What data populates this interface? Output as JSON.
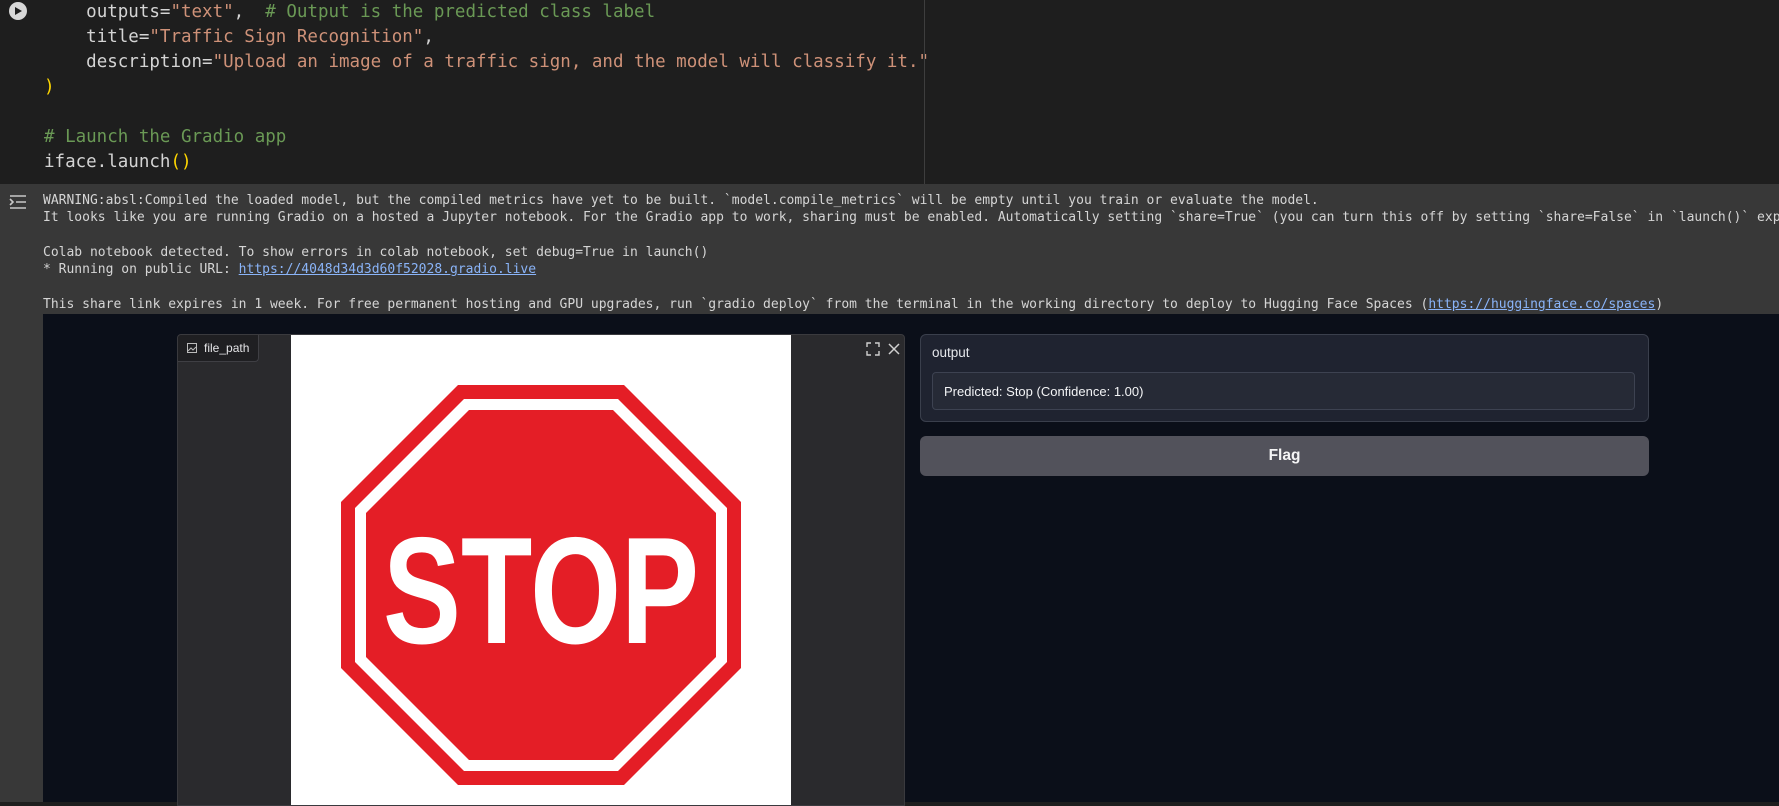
{
  "code": {
    "lines": [
      {
        "indent": "    ",
        "parts": [
          {
            "text": "outputs=",
            "cls": ""
          },
          {
            "text": "\"text\"",
            "cls": "c-str"
          },
          {
            "text": ",  ",
            "cls": ""
          },
          {
            "text": "# Output is the predicted class label",
            "cls": "c-com"
          }
        ]
      },
      {
        "indent": "    ",
        "parts": [
          {
            "text": "title=",
            "cls": ""
          },
          {
            "text": "\"Traffic Sign Recognition\"",
            "cls": "c-str"
          },
          {
            "text": ",",
            "cls": ""
          }
        ]
      },
      {
        "indent": "    ",
        "parts": [
          {
            "text": "description=",
            "cls": ""
          },
          {
            "text": "\"Upload an image of a traffic sign, and the model will classify it.\"",
            "cls": "c-str"
          }
        ]
      },
      {
        "indent": "",
        "parts": [
          {
            "text": ")",
            "cls": "c-paren"
          }
        ]
      },
      {
        "indent": "",
        "parts": []
      },
      {
        "indent": "",
        "parts": [
          {
            "text": "# Launch the Gradio app",
            "cls": "c-com"
          }
        ]
      },
      {
        "indent": "",
        "parts": [
          {
            "text": "iface.launch",
            "cls": ""
          },
          {
            "text": "()",
            "cls": "c-paren"
          }
        ]
      }
    ]
  },
  "log": {
    "lines": [
      [
        {
          "text": "WARNING:absl:Compiled the loaded model, but the compiled metrics have yet to be built. `model.compile_metrics` will be empty until you train or evaluate the model."
        }
      ],
      [
        {
          "text": "It looks like you are running Gradio on a hosted a Jupyter notebook. For the Gradio app to work, sharing must be enabled. Automatically setting `share=True` (you can turn this off by setting `share=False` in `launch()` explicit"
        }
      ],
      [],
      [
        {
          "text": "Colab notebook detected. To show errors in colab notebook, set debug=True in launch()"
        }
      ],
      [
        {
          "text": "* Running on public URL: "
        },
        {
          "text": "https://4048d34d3d60f52028.gradio.live",
          "link": true
        }
      ],
      [],
      [
        {
          "text": "This share link expires in 1 week. For free permanent hosting and GPU upgrades, run `gradio deploy` from the terminal in the working directory to deploy to Hugging Face Spaces ("
        },
        {
          "text": "https://huggingface.co/spaces",
          "link": true
        },
        {
          "text": ")"
        }
      ]
    ]
  },
  "gradio": {
    "input_label": "file_path",
    "image_text": "STOP",
    "output_label": "output",
    "output_value": "Predicted: Stop (Confidence: 1.00)",
    "flag_label": "Flag",
    "icons": {
      "run": "play-icon",
      "output_toggle": "output-toggle-icon",
      "file": "image-icon",
      "fullscreen": "fullscreen-icon",
      "close": "close-icon"
    },
    "colors": {
      "sign_red": "#e41e26",
      "flag_bg": "#52525b",
      "app_bg": "#0b0f19"
    }
  }
}
